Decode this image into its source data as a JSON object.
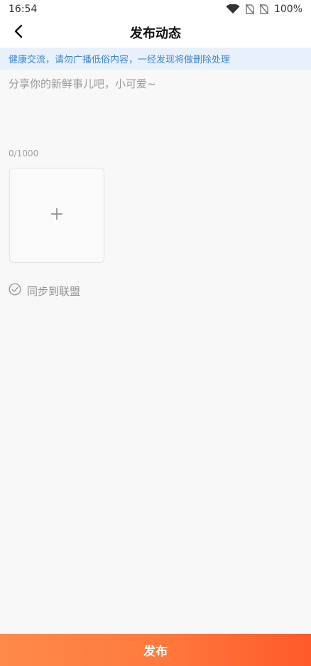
{
  "status": {
    "time": "16:54",
    "battery": "100%",
    "icons": [
      "wifi-icon",
      "no-sim-icon",
      "no-sim-icon"
    ]
  },
  "nav": {
    "title": "发布动态",
    "back_icon": "chevron-left-icon"
  },
  "notice": {
    "text": "健康交流，请勿广播低俗内容，一经发现将做删除处理"
  },
  "composer": {
    "placeholder": "分享你的新鲜事儿吧，小可爱~",
    "value": "",
    "counter": "0/1000",
    "add_image_icon": "plus-icon"
  },
  "sync": {
    "label": "同步到联盟",
    "icon": "check-circle-icon"
  },
  "publish": {
    "label": "发布"
  },
  "colors": {
    "accent_start": "#ff8a4a",
    "accent_end": "#ff5a2a",
    "notice_text": "#3a86d6",
    "notice_bg": "#e8f1fb"
  }
}
